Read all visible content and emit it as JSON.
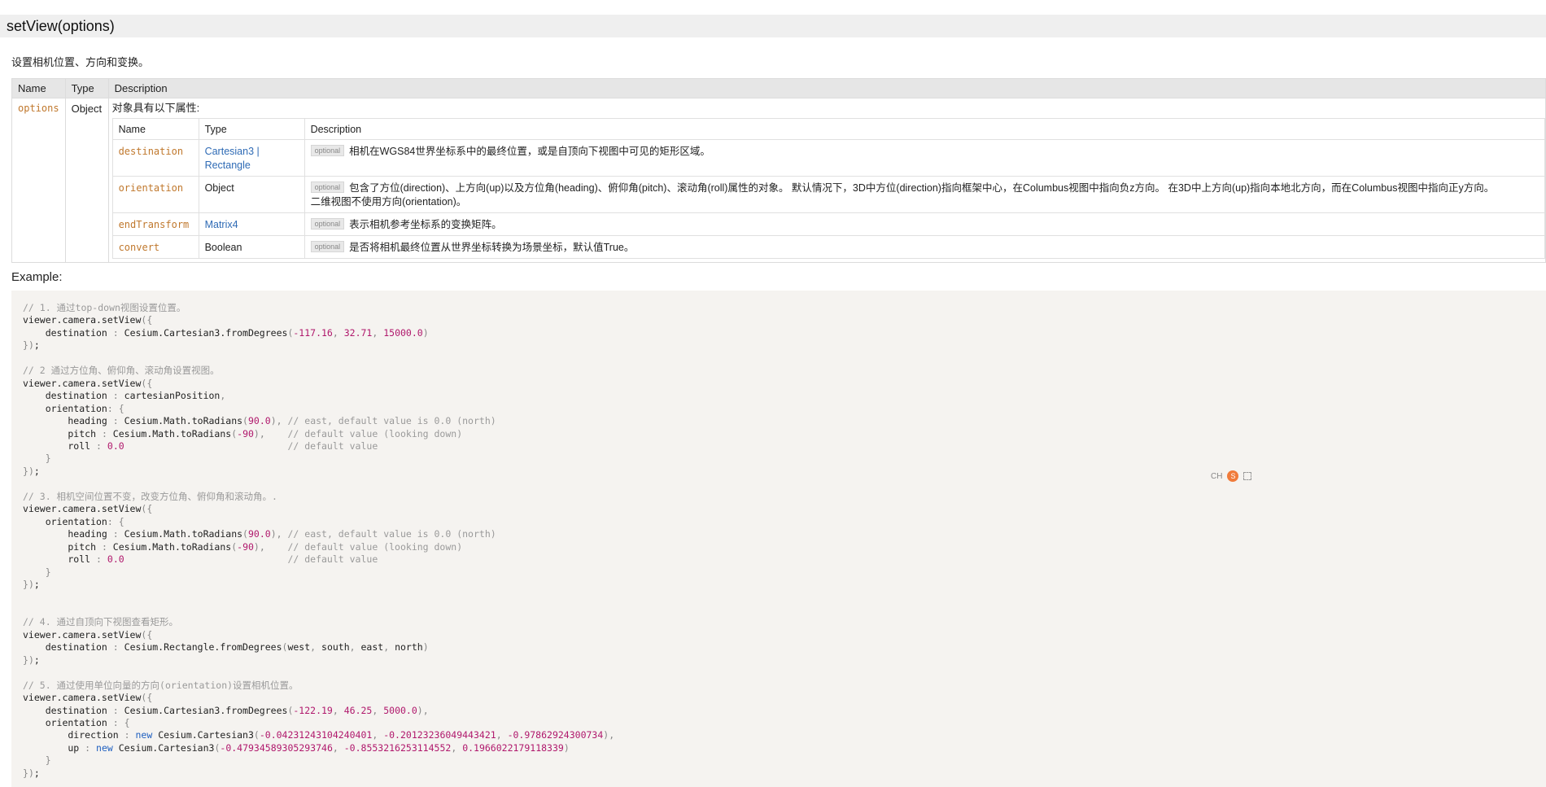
{
  "method": {
    "signature": "setView(options)",
    "description": "设置相机位置、方向和变换。"
  },
  "params_table": {
    "headers": [
      "Name",
      "Type",
      "Description"
    ],
    "row": {
      "name": "options",
      "type": "Object",
      "intro": "对象具有以下属性:"
    },
    "sub_headers": [
      "Name",
      "Type",
      "Description"
    ],
    "optional_label": "optional",
    "properties": [
      {
        "name": "destination",
        "type_line1": "Cartesian3 |",
        "type_line2": "Rectangle",
        "desc": "相机在WGS84世界坐标系中的最终位置，或是自顶向下视图中可见的矩形区域。"
      },
      {
        "name": "orientation",
        "type": "Object",
        "desc": "包含了方位(direction)、上方向(up)以及方位角(heading)、俯仰角(pitch)、滚动角(roll)属性的对象。 默认情况下，3D中方位(direction)指向框架中心，在Columbus视图中指向负z方向。 在3D中上方向(up)指向本地北方向，而在Columbus视图中指向正y方向。",
        "desc2": "二维视图不使用方向(orientation)。"
      },
      {
        "name": "endTransform",
        "type": "Matrix4",
        "desc": "表示相机参考坐标系的变换矩阵。"
      },
      {
        "name": "convert",
        "type": "Boolean",
        "desc": "是否将相机最终位置从世界坐标转换为场景坐标，默认值True。"
      }
    ]
  },
  "example": {
    "label": "Example:",
    "code_lines": [
      "// 1. 通过top-down视图设置位置。",
      "viewer.camera.setView({",
      "    destination : Cesium.Cartesian3.fromDegrees(-117.16, 32.71, 15000.0)",
      "});",
      "",
      "// 2 通过方位角、俯仰角、滚动角设置视图。",
      "viewer.camera.setView({",
      "    destination : cartesianPosition,",
      "    orientation: {",
      "        heading : Cesium.Math.toRadians(90.0), // east, default value is 0.0 (north)",
      "        pitch : Cesium.Math.toRadians(-90),    // default value (looking down)",
      "        roll : 0.0                             // default value",
      "    }",
      "});",
      "",
      "// 3. 相机空间位置不变，改变方位角、俯仰角和滚动角。.",
      "viewer.camera.setView({",
      "    orientation: {",
      "        heading : Cesium.Math.toRadians(90.0), // east, default value is 0.0 (north)",
      "        pitch : Cesium.Math.toRadians(-90),    // default value (looking down)",
      "        roll : 0.0                             // default value",
      "    }",
      "});",
      "",
      "",
      "// 4. 通过自顶向下视图查看矩形。",
      "viewer.camera.setView({",
      "    destination : Cesium.Rectangle.fromDegrees(west, south, east, north)",
      "});",
      "",
      "// 5. 通过使用单位向量的方向(orientation)设置相机位置。",
      "viewer.camera.setView({",
      "    destination : Cesium.Cartesian3.fromDegrees(-122.19, 46.25, 5000.0),",
      "    orientation : {",
      "        direction : new Cesium.Cartesian3(-0.04231243104240401, -0.20123236049443421, -0.97862924300734),",
      "        up : new Cesium.Cartesian3(-0.47934589305293746, -0.8553216253114552, 0.1966022179118339)",
      "    }",
      "});"
    ]
  },
  "floating_toolbar": {
    "lang_label": "CH",
    "icons": [
      "sogou-s-icon",
      "expand-icon"
    ]
  }
}
